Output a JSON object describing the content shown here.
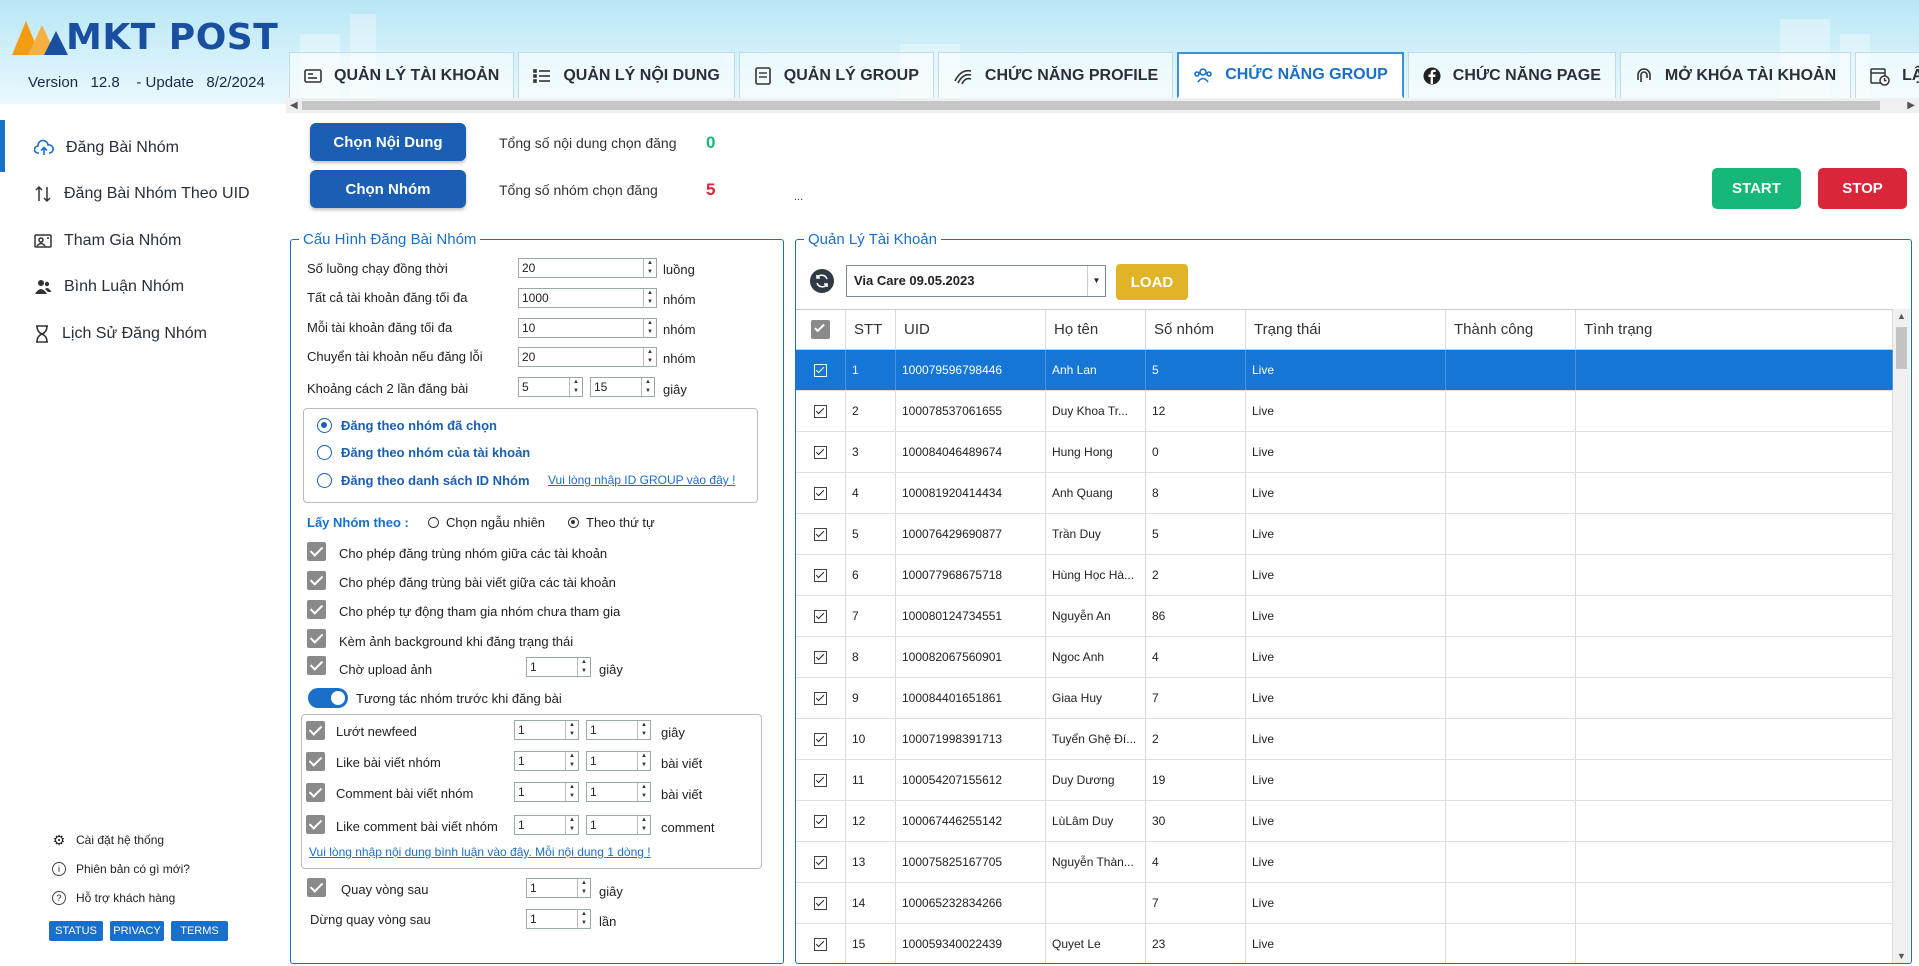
{
  "header": {
    "logo_text": "MKT POST",
    "version_text": "Version   12.8    - Update   8/2/2024",
    "tabs": [
      {
        "label": "QUẢN LÝ TÀI KHOẢN"
      },
      {
        "label": "QUẢN LÝ NỘI DUNG"
      },
      {
        "label": "QUẢN LÝ GROUP"
      },
      {
        "label": "CHỨC NĂNG PROFILE"
      },
      {
        "label": "CHỨC NĂNG GROUP"
      },
      {
        "label": "CHỨC NĂNG PAGE"
      },
      {
        "label": "MỞ KHÓA TÀI KHOẢN"
      },
      {
        "label": "LẬP LỊCH"
      }
    ],
    "active_tab": "CHỨC NĂNG GROUP"
  },
  "sidebar": {
    "items": [
      {
        "label": "Đăng Bài Nhóm",
        "icon": "cloud-upload-icon"
      },
      {
        "label": "Đăng Bài Nhóm Theo UID",
        "icon": "sort-arrows-icon"
      },
      {
        "label": "Tham Gia Nhóm",
        "icon": "join-group-icon"
      },
      {
        "label": "Bình Luận Nhóm",
        "icon": "users-icon"
      },
      {
        "label": "Lịch Sử Đăng Nhóm",
        "icon": "hourglass-icon"
      }
    ],
    "footer": {
      "settings": "Cài đặt hệ thống",
      "whats_new": "Phiên bản có gì mới?",
      "support": "Hỗ trợ khách hàng",
      "badges": [
        "STATUS",
        "PRIVACY",
        "TERMS"
      ]
    }
  },
  "toolbar": {
    "choose_content": "Chọn Nội Dung",
    "choose_group": "Chọn Nhóm",
    "total_content_label": "Tổng số nội dung chọn đăng",
    "total_content_value": "0",
    "total_group_label": "Tổng số nhóm chọn đăng",
    "total_group_value": "5",
    "ellipsis": "...",
    "start": "START",
    "stop": "STOP",
    "colors": {
      "start": "#16b877",
      "stop": "#d9263a",
      "accent": "#1a6fc9"
    }
  },
  "config": {
    "title": "Cấu Hình Đăng Bài Nhóm",
    "fields": [
      {
        "label": "Số luồng chạy đồng thời",
        "value": "20",
        "unit": "luồng"
      },
      {
        "label": "Tất cả tài khoản đăng tối đa",
        "value": "1000",
        "unit": "nhóm"
      },
      {
        "label": "Mỗi tài khoản đăng tối đa",
        "value": "10",
        "unit": "nhóm"
      },
      {
        "label": "Chuyển tài khoản nếu đăng lỗi",
        "value": "20",
        "unit": "nhóm"
      }
    ],
    "interval": {
      "label": "Khoảng cách 2 lần đăng bài",
      "from": "5",
      "to": "15",
      "unit": "giây"
    },
    "post_modes": [
      {
        "label": "Đăng theo nhóm đã chọn",
        "selected": true
      },
      {
        "label": "Đăng theo nhóm của tài khoản",
        "selected": false
      },
      {
        "label": "Đăng theo danh sách ID Nhóm",
        "selected": false
      }
    ],
    "id_group_link": "Vui lòng nhập ID GROUP vào đây !",
    "order_label": "Lấy Nhóm theo :",
    "order_random": "Chọn ngẫu nhiên",
    "order_sequential": "Theo thứ tự",
    "checks": [
      {
        "label": "Cho phép đăng trùng nhóm giữa các tài khoản",
        "checked": true
      },
      {
        "label": "Cho phép đăng trùng bài viết giữa các tài khoản",
        "checked": true
      },
      {
        "label": "Cho phép tự động tham gia nhóm chưa tham gia",
        "checked": true
      },
      {
        "label": "Kèm ảnh background khi đăng trạng thái",
        "checked": true
      }
    ],
    "upload_wait": {
      "label": "Chờ upload ảnh",
      "value": "1",
      "unit": "giây"
    },
    "interact_toggle_label": "Tương tác nhóm trước khi đăng bài",
    "interactions": [
      {
        "label": "Lướt newfeed",
        "from": "1",
        "to": "1",
        "unit": "giây"
      },
      {
        "label": "Like bài viết nhóm",
        "from": "1",
        "to": "1",
        "unit": "bài viết"
      },
      {
        "label": "Comment bài viết nhóm",
        "from": "1",
        "to": "1",
        "unit": "bài viết"
      },
      {
        "label": "Like comment bài viết nhóm",
        "from": "1",
        "to": "1",
        "unit": "comment"
      }
    ],
    "comment_link": "Vui lòng nhập nội dung bình luận vào đây. Mỗi nội dung 1 dòng !",
    "loop_after": {
      "label": "Quay vòng sau",
      "value": "1",
      "unit": "giây"
    },
    "stop_loop": {
      "label": "Dừng quay vòng sau",
      "value": "1",
      "unit": "lần"
    }
  },
  "accounts": {
    "title": "Quản Lý Tài Khoản",
    "selected_file": "Via Care 09.05.2023",
    "load": "LOAD",
    "columns": [
      "STT",
      "UID",
      "Họ tên",
      "Số nhóm",
      "Trạng thái",
      "Thành công",
      "Tình trạng"
    ],
    "rows": [
      {
        "stt": "1",
        "uid": "100079596798446",
        "name": "Anh Lan",
        "groups": "5",
        "status": "Live"
      },
      {
        "stt": "2",
        "uid": "100078537061655",
        "name": "Duy Khoa Tr...",
        "groups": "12",
        "status": "Live"
      },
      {
        "stt": "3",
        "uid": "100084046489674",
        "name": "Hung Hong",
        "groups": "0",
        "status": "Live"
      },
      {
        "stt": "4",
        "uid": "100081920414434",
        "name": "Anh Quang",
        "groups": "8",
        "status": "Live"
      },
      {
        "stt": "5",
        "uid": "100076429690877",
        "name": "Trần Duy",
        "groups": "5",
        "status": "Live"
      },
      {
        "stt": "6",
        "uid": "100077968675718",
        "name": "Hùng Học Hà...",
        "groups": "2",
        "status": "Live"
      },
      {
        "stt": "7",
        "uid": "100080124734551",
        "name": "Nguyễn An",
        "groups": "86",
        "status": "Live"
      },
      {
        "stt": "8",
        "uid": "100082067560901",
        "name": "Ngoc Anh",
        "groups": "4",
        "status": "Live"
      },
      {
        "stt": "9",
        "uid": "100084401651861",
        "name": "Giaa Huy",
        "groups": "7",
        "status": "Live"
      },
      {
        "stt": "10",
        "uid": "100071998391713",
        "name": "Tuyển Ghệ Đí...",
        "groups": "2",
        "status": "Live"
      },
      {
        "stt": "11",
        "uid": "100054207155612",
        "name": "Duy Dương",
        "groups": "19",
        "status": "Live"
      },
      {
        "stt": "12",
        "uid": "100067446255142",
        "name": "LùLâm Duy",
        "groups": "30",
        "status": "Live"
      },
      {
        "stt": "13",
        "uid": "100075825167705",
        "name": "Nguyễn Thàn...",
        "groups": "4",
        "status": "Live"
      },
      {
        "stt": "14",
        "uid": "100065232834266",
        "name": "",
        "groups": "7",
        "status": "Live"
      },
      {
        "stt": "15",
        "uid": "100059340022439",
        "name": "Quyet Le",
        "groups": "23",
        "status": "Live"
      }
    ]
  }
}
